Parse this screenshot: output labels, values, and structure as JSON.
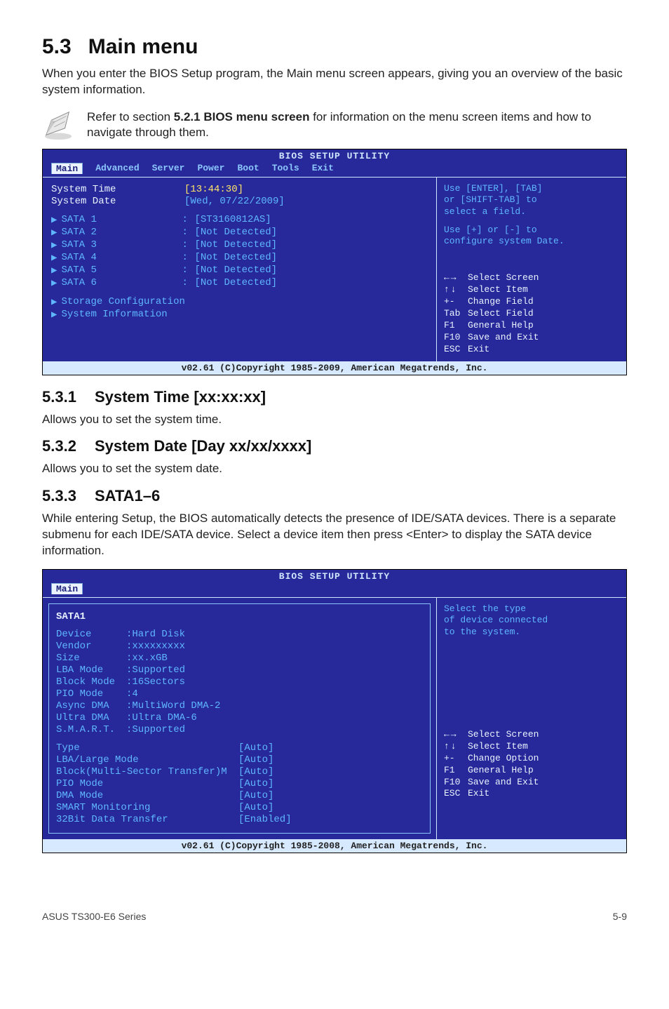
{
  "section": {
    "num": "5.3",
    "title": "Main menu",
    "intro": "When you enter the BIOS Setup program, the Main menu screen appears, giving you an overview of the basic system information.",
    "note": "Refer to section 5.2.1 BIOS menu screen for information on the menu screen items and how to navigate through them.",
    "note_bold": "5.2.1 BIOS menu screen"
  },
  "bios_main": {
    "utility_title": "BIOS SETUP UTILITY",
    "tabs": [
      "Main",
      "Advanced",
      "Server",
      "Power",
      "Boot",
      "Tools",
      "Exit"
    ],
    "active_tab": "Main",
    "time_label": "System Time",
    "time_val": "[13:44:30]",
    "date_label": "System Date",
    "date_val": "[Wed, 07/22/2009]",
    "sata": [
      {
        "label": "SATA 1",
        "val": "[ST3160812AS]"
      },
      {
        "label": "SATA 2",
        "val": "[Not Detected]"
      },
      {
        "label": "SATA 3",
        "val": "[Not Detected]"
      },
      {
        "label": "SATA 4",
        "val": "[Not Detected]"
      },
      {
        "label": "SATA 5",
        "val": "[Not Detected]"
      },
      {
        "label": "SATA 6",
        "val": "[Not Detected]"
      }
    ],
    "menu_items": [
      "Storage Configuration",
      "System Information"
    ],
    "hint_lines": [
      "Use [ENTER], [TAB]",
      "or [SHIFT-TAB] to",
      "select a field."
    ],
    "hint2_lines": [
      "Use [+] or [-] to",
      "configure system Date."
    ],
    "help": [
      {
        "k": "←→",
        "t": "Select Screen"
      },
      {
        "k": "↑↓",
        "t": "Select Item"
      },
      {
        "k": "+-",
        "t": "Change Field"
      },
      {
        "k": "Tab",
        "t": "Select Field"
      },
      {
        "k": "F1",
        "t": "General Help"
      },
      {
        "k": "F10",
        "t": "Save and Exit"
      },
      {
        "k": "ESC",
        "t": "Exit"
      }
    ],
    "footer": "v02.61 (C)Copyright 1985-2009, American Megatrends, Inc."
  },
  "s531": {
    "num": "5.3.1",
    "title": "System Time [xx:xx:xx]",
    "text": "Allows you to set the system time."
  },
  "s532": {
    "num": "5.3.2",
    "title": "System Date [Day xx/xx/xxxx]",
    "text": "Allows you to set the system date."
  },
  "s533": {
    "num": "5.3.3",
    "title": "SATA1–6",
    "text": "While entering Setup, the BIOS automatically detects the presence of IDE/SATA devices. There is a separate submenu for each IDE/SATA device. Select a device item then press <Enter> to display the SATA device information."
  },
  "bios_sata": {
    "utility_title": "BIOS SETUP UTILITY",
    "tab": "Main",
    "header": "SATA1",
    "info": [
      {
        "l": "Device",
        "v": ":Hard Disk"
      },
      {
        "l": "Vendor",
        "v": ":xxxxxxxxx"
      },
      {
        "l": "Size",
        "v": ":xx.xGB"
      },
      {
        "l": "LBA Mode",
        "v": ":Supported"
      },
      {
        "l": "Block Mode",
        "v": ":16Sectors"
      },
      {
        "l": "PIO Mode",
        "v": ":4"
      },
      {
        "l": "Async DMA",
        "v": ":MultiWord DMA-2"
      },
      {
        "l": "Ultra DMA",
        "v": ":Ultra DMA-6"
      },
      {
        "l": "S.M.A.R.T.",
        "v": ":Supported"
      }
    ],
    "opts": [
      {
        "l": "Type",
        "v": "[Auto]"
      },
      {
        "l": "LBA/Large Mode",
        "v": "[Auto]"
      },
      {
        "l": "Block(Multi-Sector Transfer)M",
        "v": "[Auto]"
      },
      {
        "l": "PIO Mode",
        "v": "[Auto]"
      },
      {
        "l": "DMA Mode",
        "v": "[Auto]"
      },
      {
        "l": "SMART Monitoring",
        "v": "[Auto]"
      },
      {
        "l": "32Bit Data Transfer",
        "v": "[Enabled]"
      }
    ],
    "hint_lines": [
      "Select the type",
      "of device connected",
      "to the system."
    ],
    "help": [
      {
        "k": "←→",
        "t": "Select Screen"
      },
      {
        "k": "↑↓",
        "t": "Select Item"
      },
      {
        "k": "+-",
        "t": "Change Option"
      },
      {
        "k": "F1",
        "t": "General Help"
      },
      {
        "k": "F10",
        "t": "Save and Exit"
      },
      {
        "k": "ESC",
        "t": "Exit"
      }
    ],
    "footer": "v02.61 (C)Copyright 1985-2008, American Megatrends, Inc."
  },
  "page_footer": {
    "left": "ASUS TS300-E6 Series",
    "right": "5-9"
  }
}
